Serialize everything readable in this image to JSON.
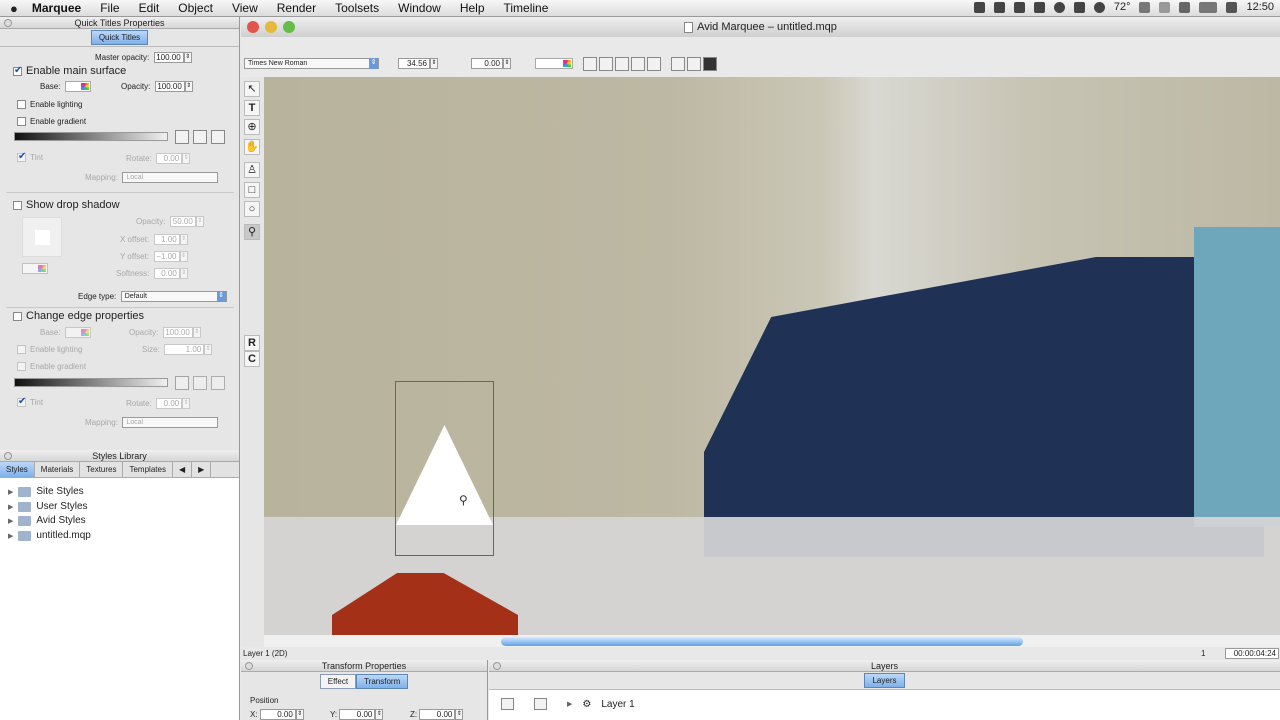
{
  "menubar": {
    "apple": "",
    "app": "Marquee",
    "items": [
      "File",
      "Edit",
      "Object",
      "View",
      "Render",
      "Toolsets",
      "Window",
      "Help",
      "Timeline"
    ],
    "temp": "72°",
    "clock": "12:50"
  },
  "quick_titles": {
    "title": "Quick Titles Properties",
    "tab": "Quick Titles",
    "master_opacity_label": "Master opacity:",
    "master_opacity": "100.00",
    "enable_main_surface": "Enable main surface",
    "base_label": "Base:",
    "opacity_label": "Opacity:",
    "opacity": "100.00",
    "enable_lighting": "Enable lighting",
    "enable_gradient": "Enable gradient",
    "tint": "Tint",
    "rotate_label": "Rotate:",
    "rotate": "0.00",
    "mapping_label": "Mapping:",
    "mapping": "Local",
    "show_drop_shadow": "Show drop shadow",
    "ds_opacity": "50.00",
    "x_offset_label": "X offset:",
    "x_offset": "1.00",
    "y_offset_label": "Y offset:",
    "y_offset": "−1.00",
    "softness_label": "Softness:",
    "softness": "0.00",
    "edge_type_label": "Edge type:",
    "edge_type": "Default",
    "change_edge": "Change edge properties",
    "edge_opacity": "100.00",
    "size_label": "Size:",
    "size": "1.00",
    "edge_rotate": "0.00",
    "edge_mapping": "Local"
  },
  "styles_library": {
    "title": "Styles Library",
    "tabs": [
      "Styles",
      "Materials",
      "Textures",
      "Templates"
    ],
    "items": [
      "Site Styles",
      "User Styles",
      "Avid Styles",
      "untitled.mqp"
    ]
  },
  "window": {
    "title": "Avid Marquee – untitled.mqp",
    "font": "Times New Roman",
    "font_size": "34.56",
    "kerning": "0.00"
  },
  "status": {
    "layer": "Layer 1 (2D)",
    "frame": "1",
    "timecode": "00:00:04:24"
  },
  "transform": {
    "title": "Transform Properties",
    "tabs": [
      "Effect",
      "Transform"
    ],
    "position": "Position",
    "x_label": "X:",
    "x": "0.00",
    "y_label": "Y:",
    "y": "0.00",
    "z_label": "Z:",
    "z": "0.00"
  },
  "layers": {
    "title": "Layers",
    "tab": "Layers",
    "layer_name": "Layer 1"
  },
  "colors": {
    "selection": "#e0342d",
    "accent": "#7fb0ea",
    "triangle": "#ffffff",
    "shape_red": "#a53018"
  }
}
